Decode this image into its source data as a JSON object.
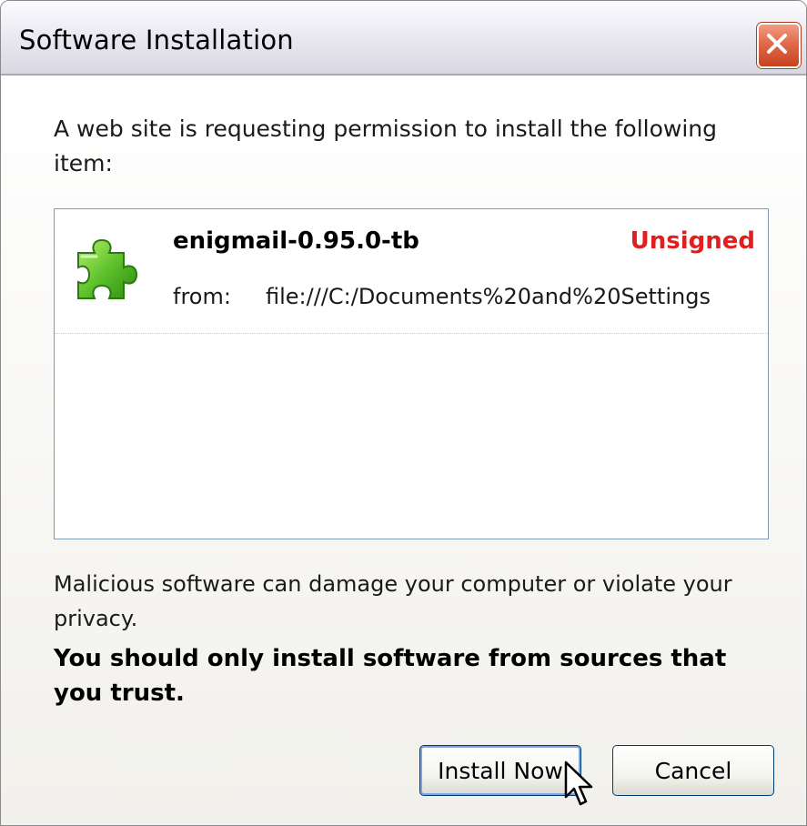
{
  "window": {
    "title": "Software Installation",
    "close_icon": "close-x-icon",
    "close_color": "#e06a4a"
  },
  "message": {
    "intro": "A web site is requesting permission to install the following item:",
    "warning": "Malicious software can damage your computer or violate your privacy.",
    "trust": "You should only install software from sources that you trust."
  },
  "items": [
    {
      "icon": "puzzle-piece-icon",
      "name": "enigmail-0.95.0-tb",
      "status": "Unsigned",
      "status_color": "#e02020",
      "from_label": "from:",
      "from_url": "file:///C:/Documents%20and%20Settings"
    }
  ],
  "buttons": {
    "install_label": "Install Now",
    "cancel_label": "Cancel"
  }
}
